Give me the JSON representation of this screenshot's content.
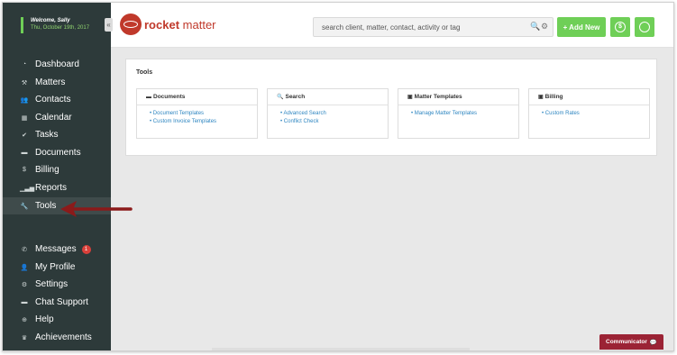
{
  "welcome": {
    "greeting": "Welcome, Sally",
    "date": "Thu, October 19th, 2017"
  },
  "collapse_glyph": "«",
  "nav": {
    "main": [
      {
        "id": "dashboard",
        "label": "Dashboard",
        "icon": "dashboard-icon",
        "glyph": "◔"
      },
      {
        "id": "matters",
        "label": "Matters",
        "icon": "gavel-icon",
        "glyph": "⚒"
      },
      {
        "id": "contacts",
        "label": "Contacts",
        "icon": "contacts-icon",
        "glyph": "👥"
      },
      {
        "id": "calendar",
        "label": "Calendar",
        "icon": "calendar-icon",
        "glyph": "▦"
      },
      {
        "id": "tasks",
        "label": "Tasks",
        "icon": "check-icon",
        "glyph": "✔"
      },
      {
        "id": "documents",
        "label": "Documents",
        "icon": "folder-icon",
        "glyph": "▬"
      },
      {
        "id": "billing",
        "label": "Billing",
        "icon": "dollar-circle-icon",
        "glyph": "$"
      },
      {
        "id": "reports",
        "label": "Reports",
        "icon": "bar-chart-icon",
        "glyph": "▁▃▅"
      },
      {
        "id": "tools",
        "label": "Tools",
        "icon": "wrench-icon",
        "glyph": "🔧",
        "active": true
      }
    ],
    "secondary": [
      {
        "id": "messages",
        "label": "Messages",
        "icon": "phone-icon",
        "glyph": "✆",
        "badge": "1"
      },
      {
        "id": "my-profile",
        "label": "My Profile",
        "icon": "user-icon",
        "glyph": "👤"
      },
      {
        "id": "settings",
        "label": "Settings",
        "icon": "gear-icon",
        "glyph": "⚙"
      },
      {
        "id": "chat-support",
        "label": "Chat Support",
        "icon": "chat-icon",
        "glyph": "▬"
      },
      {
        "id": "help",
        "label": "Help",
        "icon": "lifebuoy-icon",
        "glyph": "⊕"
      },
      {
        "id": "achievements",
        "label": "Achievements",
        "icon": "trophy-icon",
        "glyph": "♛"
      }
    ]
  },
  "brand": {
    "word1": "rocket",
    "word2": "matter"
  },
  "search": {
    "placeholder": "search client, matter, contact, activity or tag",
    "value": "",
    "search_glyph": "🔍",
    "gear_glyph": "⚙"
  },
  "toolbar": {
    "add_new_label": "+ Add New",
    "billing_glyph": "$",
    "timer_glyph": "⏱"
  },
  "tools_panel": {
    "title": "Tools",
    "cards": [
      {
        "id": "documents",
        "title": "Documents",
        "icon": "folder-icon",
        "glyph": "▬",
        "links": [
          "Document Templates",
          "Custom Invoice Templates"
        ]
      },
      {
        "id": "search",
        "title": "Search",
        "icon": "search-icon",
        "glyph": "🔍",
        "links": [
          "Advanced Search",
          "Conflict Check"
        ]
      },
      {
        "id": "matter-templates",
        "title": "Matter Templates",
        "icon": "template-icon",
        "glyph": "▣",
        "links": [
          "Manage Matter Templates"
        ]
      },
      {
        "id": "billing",
        "title": "Billing",
        "icon": "template-icon",
        "glyph": "▣",
        "links": [
          "Custom Rates"
        ]
      }
    ]
  },
  "communicator": {
    "label": "Communicator",
    "glyph": "💬"
  },
  "colors": {
    "sidebar": "#2d3a3a",
    "accent_green": "#6fcf57",
    "brand_red": "#c0392b",
    "link_blue": "#2e86c1",
    "communicator": "#9b2335",
    "arrow": "#8b1a1a"
  }
}
